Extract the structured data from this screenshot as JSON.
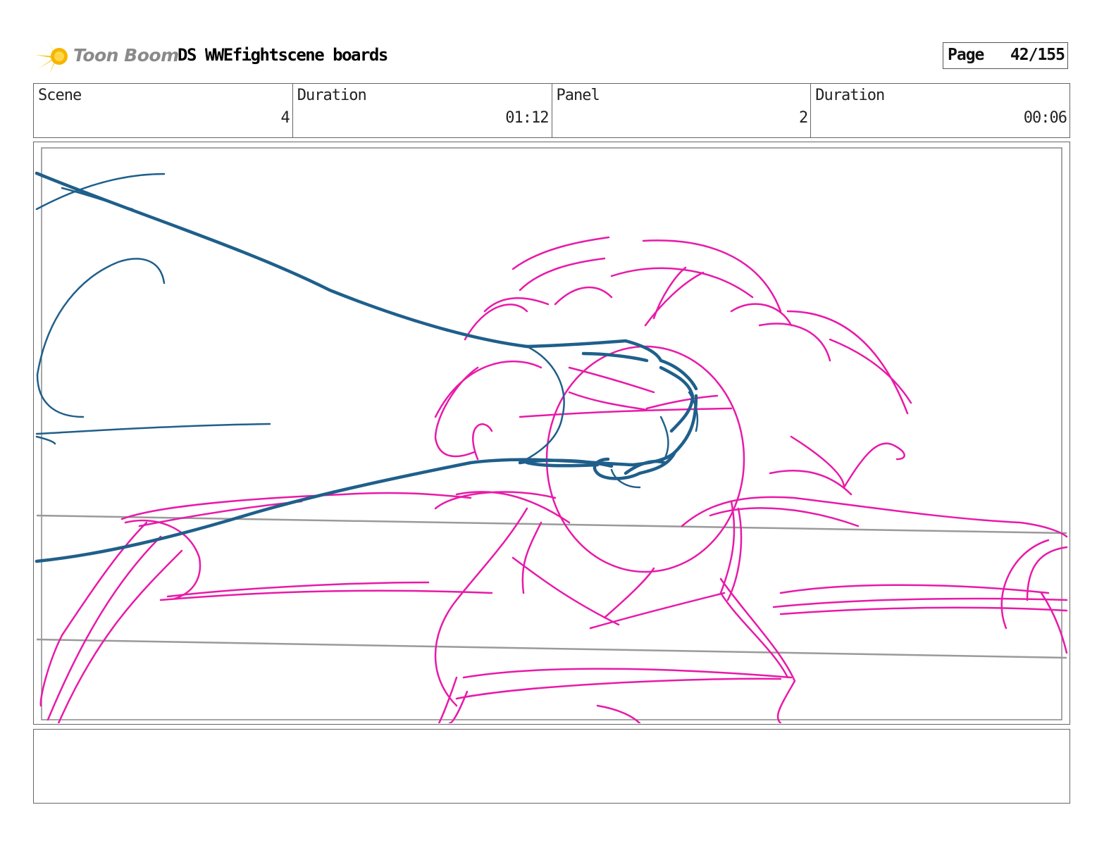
{
  "header": {
    "brand": "Toon Boom",
    "title": "DS WWEfightscene boards",
    "page_label": "Page",
    "page_value": "42/155"
  },
  "info": {
    "scene_label": "Scene",
    "scene_value": "4",
    "scene_duration_label": "Duration",
    "scene_duration_value": "01:12",
    "panel_label": "Panel",
    "panel_value": "2",
    "panel_duration_label": "Duration",
    "panel_duration_value": "00:06"
  },
  "notes": {
    "text": ""
  },
  "colors": {
    "sketch_blue": "#1f5f8b",
    "sketch_magenta": "#e81aa8",
    "guide_gray": "#9a9a9a",
    "logo_yellow": "#f5c400"
  },
  "icons": {
    "logo": "toon-boom-star-logo"
  }
}
